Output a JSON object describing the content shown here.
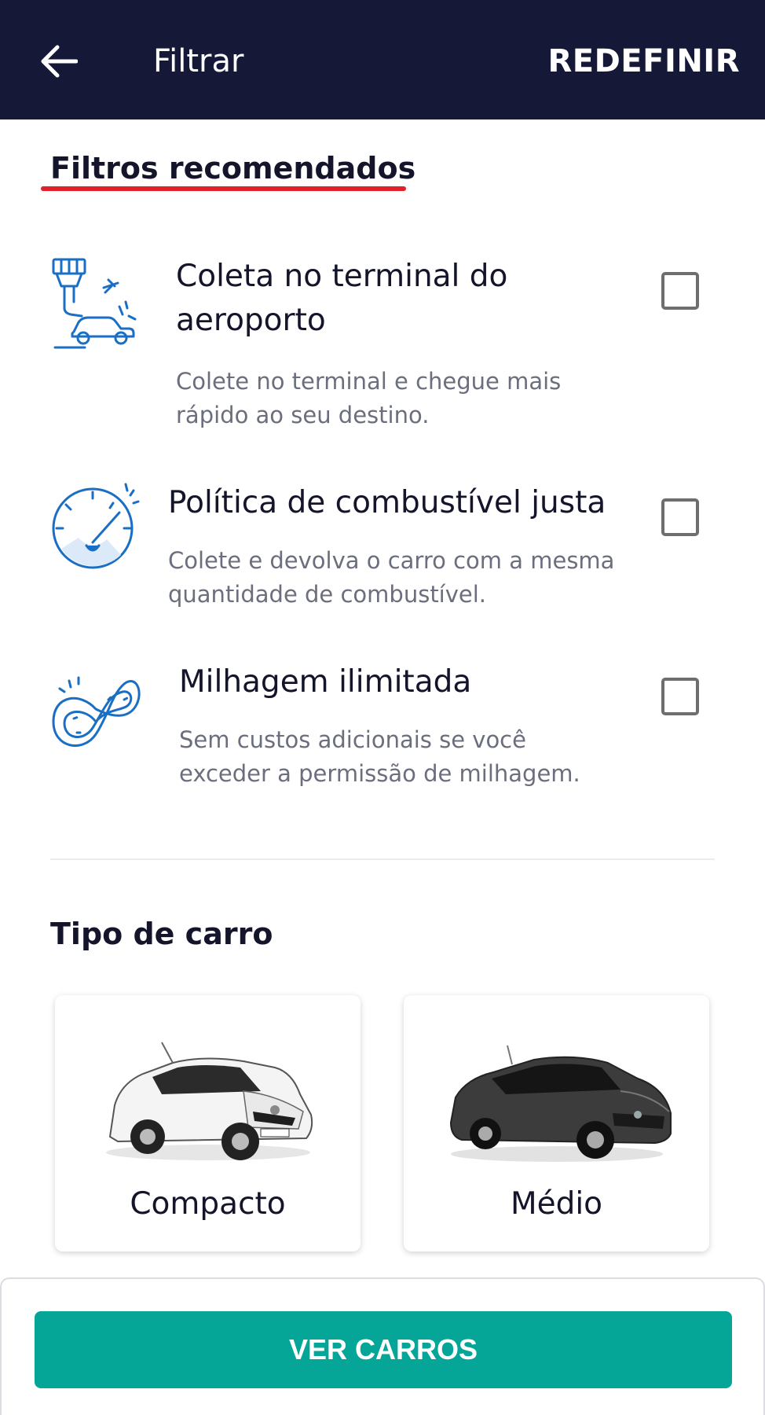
{
  "header": {
    "title": "Filtrar",
    "reset_label": "REDEFINIR"
  },
  "recommended": {
    "title": "Filtros recomendados",
    "items": [
      {
        "icon": "airport-pickup-icon",
        "title_line1": "Coleta no terminal do",
        "title_line2": "aeroporto",
        "desc_line1": "Colete no terminal e chegue mais",
        "desc_line2": "rápido ao seu destino.",
        "checked": false
      },
      {
        "icon": "fuel-gauge-icon",
        "title_line1": "Política de combustível justa",
        "desc_line1": "Colete e devolva o carro com a mesma",
        "desc_line2": "quantidade de combustível.",
        "checked": false
      },
      {
        "icon": "infinity-road-icon",
        "title_line1": "Milhagem ilimitada",
        "desc_line1": "Sem custos adicionais se você",
        "desc_line2": "exceder a permissão de milhagem.",
        "checked": false
      }
    ]
  },
  "car_type": {
    "title": "Tipo de carro",
    "cards": [
      {
        "label": "Compacto",
        "color": "#f2f2f2"
      },
      {
        "label": "Médio",
        "color": "#3c3c3c"
      }
    ]
  },
  "cta": {
    "label": "VER CARROS"
  },
  "colors": {
    "header_bg": "#151937",
    "accent_red": "#e4202a",
    "icon_blue": "#1a6fc4",
    "cta_green": "#05a597"
  }
}
